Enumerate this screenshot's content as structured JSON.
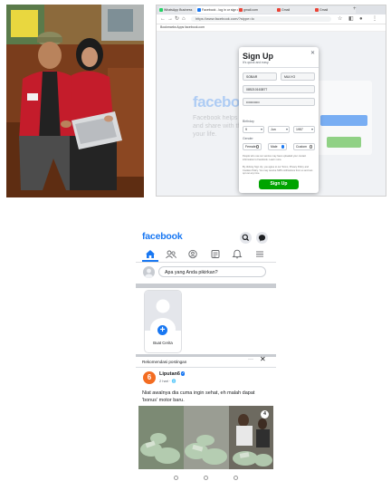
{
  "colors": {
    "facebook_blue": "#1877f2",
    "signup_green": "#00a400",
    "liputan6_orange": "#f36c21",
    "jacket_red": "#c41c2b"
  },
  "browser": {
    "tabs": [
      {
        "label": "WhatsApp Business"
      },
      {
        "label": "Facebook - log in or sign up"
      },
      {
        "label": "gmail.com"
      },
      {
        "label": "Gmail"
      },
      {
        "label": "Gmail"
      }
    ],
    "url": "https://www.facebook.com/?stype=lo",
    "bookmarks": "Bookmarks   Apps   facebook.com",
    "bg_logo": "facebook",
    "bg_tagline": "Facebook helps you connect and share with the people in your life.",
    "signup": {
      "title": "Sign Up",
      "subtitle": "It's quick and easy.",
      "first_name": "SOBAR",
      "last_name": "MULYO",
      "email": "085210163877",
      "password": "••••••••••••",
      "birthday_label": "Birthday",
      "birthday_day": "9",
      "birthday_month": "Jun",
      "birthday_year": "1957",
      "gender_label": "Gender",
      "gender_options": [
        "Female",
        "Male",
        "Custom"
      ],
      "gender_selected": "Male",
      "fine_print_1": "People who use our service may have uploaded your contact information to Facebook. Learn more.",
      "fine_print_2": "By clicking Sign Up, you agree to our Terms, Privacy Policy and Cookies Policy. You may receive SMS notifications from us and can opt out any time.",
      "submit_label": "Sign Up",
      "close_icon": "close-icon"
    }
  },
  "phone": {
    "logo": "facebook",
    "header_icons": [
      "search-icon",
      "messenger-icon"
    ],
    "nav_icons": [
      "home-icon",
      "friends-icon",
      "profile-icon",
      "news-icon",
      "notifications-icon",
      "menu-icon"
    ],
    "composer_placeholder": "Apa yang Anda pikirkan?",
    "story_label": "Buat Cerita",
    "story_plus": "+",
    "recommended_label": "Rekomendasi postingan",
    "more_icon": "···",
    "close_icon": "✕",
    "post": {
      "author": "Liputan6",
      "avatar_letter": "6",
      "verified": "✓",
      "time": "2 hari · 🌐",
      "text": "Niat awalnya dia cuma ingin sehat, eh malah dapat 'bonus' motor baru.",
      "image_badge": "4"
    }
  }
}
